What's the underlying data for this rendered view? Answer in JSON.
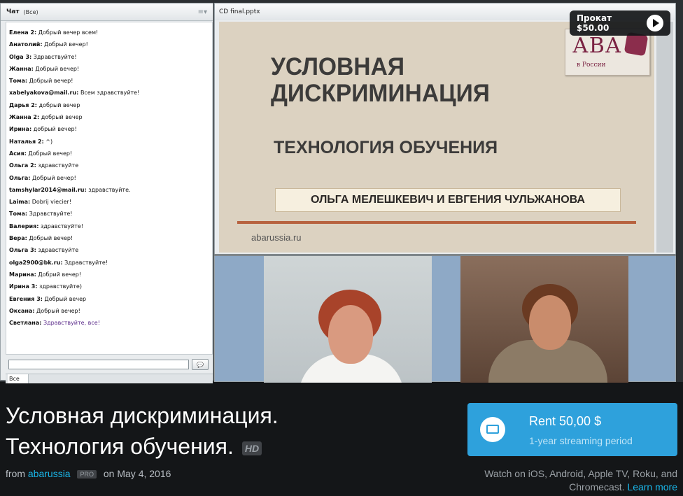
{
  "chat": {
    "title": "Чат",
    "filter": "(Все)",
    "menu_icon": "≡▾",
    "messages": [
      {
        "who": "Елена 2:",
        "text": "Добрый вечер всем!"
      },
      {
        "who": "Анатолий:",
        "text": "Добрый вечер!"
      },
      {
        "who": "Olga 3:",
        "text": "Здравствуйте!"
      },
      {
        "who": "Жанна:",
        "text": "Добрый вечер!"
      },
      {
        "who": "Тома:",
        "text": "Добрый вечер!"
      },
      {
        "who": "xabelyakova@mail.ru:",
        "text": "Всем здравствуйте!"
      },
      {
        "who": "Дарья 2:",
        "text": "добрый вечер"
      },
      {
        "who": "Жанна 2:",
        "text": "добрый вечер"
      },
      {
        "who": "Ирина:",
        "text": "добрый вечер!"
      },
      {
        "who": "Наталья 2:",
        "text": "^)"
      },
      {
        "who": "Асия:",
        "text": "Добрый вечер!"
      },
      {
        "who": "Ольга 2:",
        "text": "здравствуйте"
      },
      {
        "who": "Ольга:",
        "text": "Добрый вечер!"
      },
      {
        "who": "tamshylar2014@mail.ru:",
        "text": "здравствуйте."
      },
      {
        "who": "Laima:",
        "text": "Dobrij viecier!"
      },
      {
        "who": "Тома:",
        "text": "Здравствуйте!"
      },
      {
        "who": "Валерия:",
        "text": "здравствуйте!"
      },
      {
        "who": "Вера:",
        "text": "Добрый вечер!"
      },
      {
        "who": "Ольга 3:",
        "text": "здравствуйте"
      },
      {
        "who": "olga2900@bk.ru:",
        "text": "Здравствуйте!"
      },
      {
        "who": "Марина:",
        "text": "Добрий вечер!"
      },
      {
        "who": "Ирина 3:",
        "text": "здравствуйте)"
      },
      {
        "who": "Евгения 3:",
        "text": "Добрый вечер"
      },
      {
        "who": "Оксана:",
        "text": "Добрый вечер!"
      },
      {
        "who": "Светлана:",
        "text": "Здравствуйте, все!"
      }
    ],
    "input_value": "",
    "footer_select": "Все"
  },
  "slide": {
    "file": "CD final.pptx",
    "logo_text": "АВА",
    "logo_sub": "в России",
    "title_line1": "УСЛОВНАЯ",
    "title_line2": "ДИСКРИМИНАЦИЯ",
    "subtitle": "ТЕХНОЛОГИЯ ОБУЧЕНИЯ",
    "authors": "ОЛЬГА МЕЛЕШКЕВИЧ И ЕВГЕНИЯ ЧУЛЬЖАНОВА",
    "url": "abarussia.ru"
  },
  "overlay": {
    "rent_label": "Прокат $50.00"
  },
  "video": {
    "title_line1": "Условная дискриминация.",
    "title_line2": "Технология обучения.",
    "hd": "HD",
    "from": "from",
    "author": "abarussia",
    "pro": "PRO",
    "date": "on May 4, 2016"
  },
  "rent": {
    "price": "Rent 50,00 $",
    "period": "1-year streaming period",
    "platforms": "Watch on iOS, Android, Apple TV, Roku, and Chromecast.",
    "learn_more": "Learn more"
  },
  "colors": {
    "accent": "#2ea1dc",
    "link": "#1ab7ea",
    "slide_bg": "#dcd2c1",
    "slide_rule": "#b7623f"
  }
}
